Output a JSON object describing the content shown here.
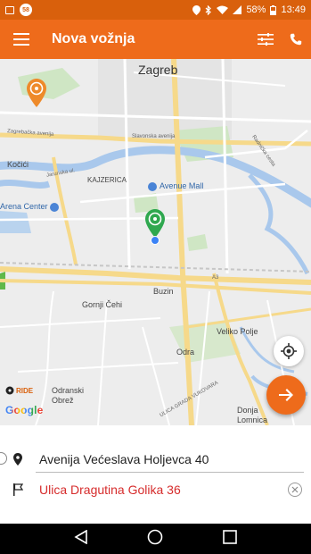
{
  "status_bar": {
    "notification_badge": "58",
    "battery": "58%",
    "time": "13:49"
  },
  "app_bar": {
    "title": "Nova vožnja",
    "menu_icon": "hamburger-menu-icon",
    "filter_icon": "sliders-icon",
    "phone_icon": "phone-icon"
  },
  "map": {
    "labels": {
      "city": "Zagreb",
      "kajzerica": "KAJZERICA",
      "avenue_mall": "Avenue Mall",
      "arena_center": "Arena Center",
      "kocici": "Kočići",
      "buzin": "Buzin",
      "gornji_cehi": "Gornji Čehi",
      "veliko_polje": "Veliko Polje",
      "odra": "Odra",
      "odranski_obrez": "Odranski\nObrež",
      "donja_lomnica": "Donja\nLomnica",
      "road_zagrebacka": "Zagrebačka avenija",
      "road_slavonska": "Slavonska avenija",
      "road_jarunska": "Jarunska ul.",
      "road_radnicka": "Radnička cesta",
      "road_a3": "A3",
      "road_ulica_grada": "ULICA GRADA VUKOVARA"
    },
    "branding": {
      "ride": "RIDE",
      "google": "Google"
    },
    "colors": {
      "accent": "#ee6b1b",
      "pin_green": "#2fa84f",
      "pin_orange": "#ee8a2a",
      "user_dot": "#3b82f6"
    }
  },
  "addresses": {
    "from": "Avenija Većeslava Holjevca 40",
    "to": "Ulica Dragutina Golika 36"
  },
  "nav_bar": {
    "back": "back-icon",
    "home": "home-icon",
    "recents": "recents-icon"
  }
}
